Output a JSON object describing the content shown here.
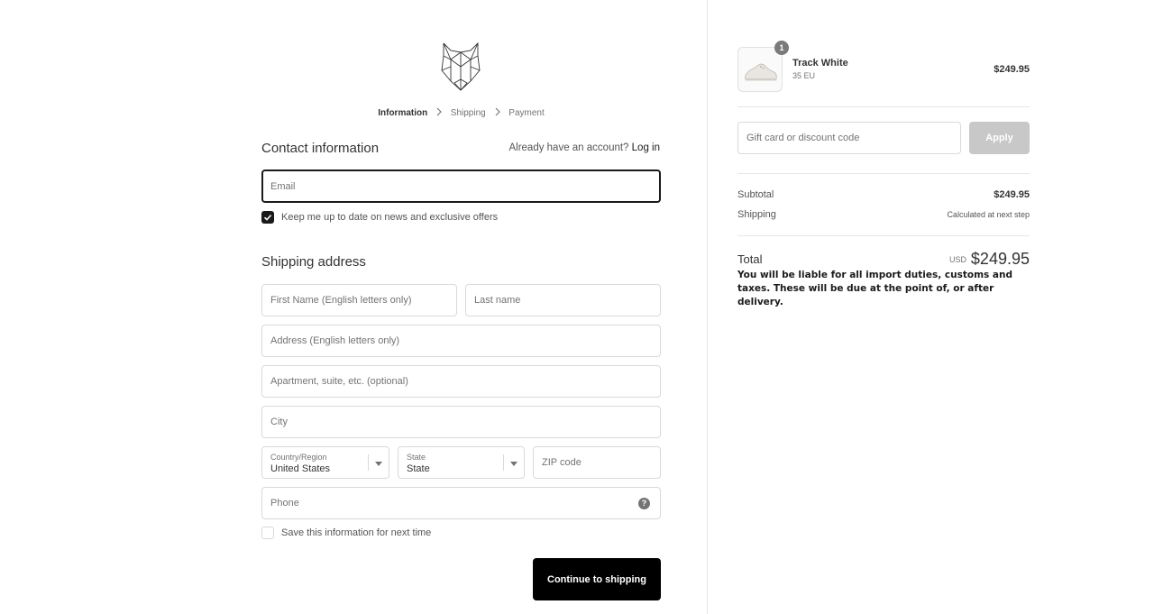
{
  "breadcrumb": {
    "step1": "Information",
    "step2": "Shipping",
    "step3": "Payment"
  },
  "contact": {
    "title": "Contact information",
    "account_prompt": "Already have an account?",
    "login_link": "Log in",
    "email_placeholder": "Email",
    "newsletter_label": "Keep me up to date on news and exclusive offers",
    "newsletter_checked": true
  },
  "shipping": {
    "title": "Shipping address",
    "first_name_placeholder": "First Name (English letters only)",
    "last_name_placeholder": "Last name",
    "address_placeholder": "Address (English letters only)",
    "apartment_placeholder": "Apartment, suite, etc. (optional)",
    "city_placeholder": "City",
    "country_label": "Country/Region",
    "country_value": "United States",
    "state_label": "State",
    "state_value": "State",
    "zip_placeholder": "ZIP code",
    "phone_placeholder": "Phone",
    "phone_help_icon": "?",
    "save_info_label": "Save this information for next time",
    "save_info_checked": false,
    "continue_label": "Continue to shipping"
  },
  "cart": {
    "item_quantity": "1",
    "item_name": "Track White",
    "item_variant": "35 EU",
    "item_price": "$249.95",
    "discount_placeholder": "Gift card or discount code",
    "apply_label": "Apply",
    "subtotal_label": "Subtotal",
    "subtotal_value": "$249.95",
    "shipping_label": "Shipping",
    "shipping_value": "Calculated at next step",
    "total_label": "Total",
    "total_currency": "USD",
    "total_value": "$249.95",
    "duties_note": "You will be liable for all import duties, customs and taxes. These will be due at the point of, or after delivery."
  },
  "colors": {
    "primary_button": "#000000",
    "apply_disabled": "#c8c8c8",
    "focus_border": "#1a1a1a"
  }
}
